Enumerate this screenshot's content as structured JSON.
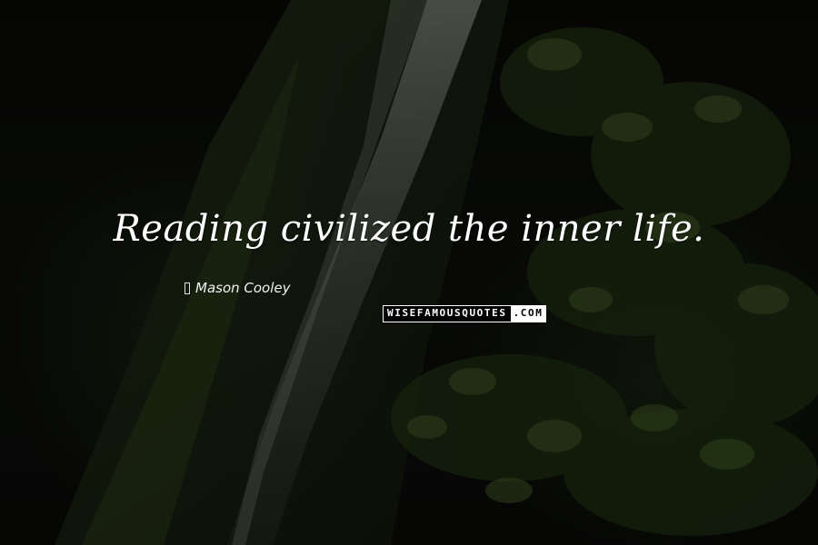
{
  "quote": {
    "text": "Reading civilized the inner life."
  },
  "author": {
    "name": "Mason Cooley"
  },
  "watermark": {
    "main": "WISEFAMOUSQUOTES",
    "tld": ".COM"
  },
  "background": {
    "subject": "waterfall over mossy cliff with leaves",
    "palette": [
      "#050605",
      "#1c2614",
      "#3b4a2a",
      "#8f9a8c"
    ]
  }
}
